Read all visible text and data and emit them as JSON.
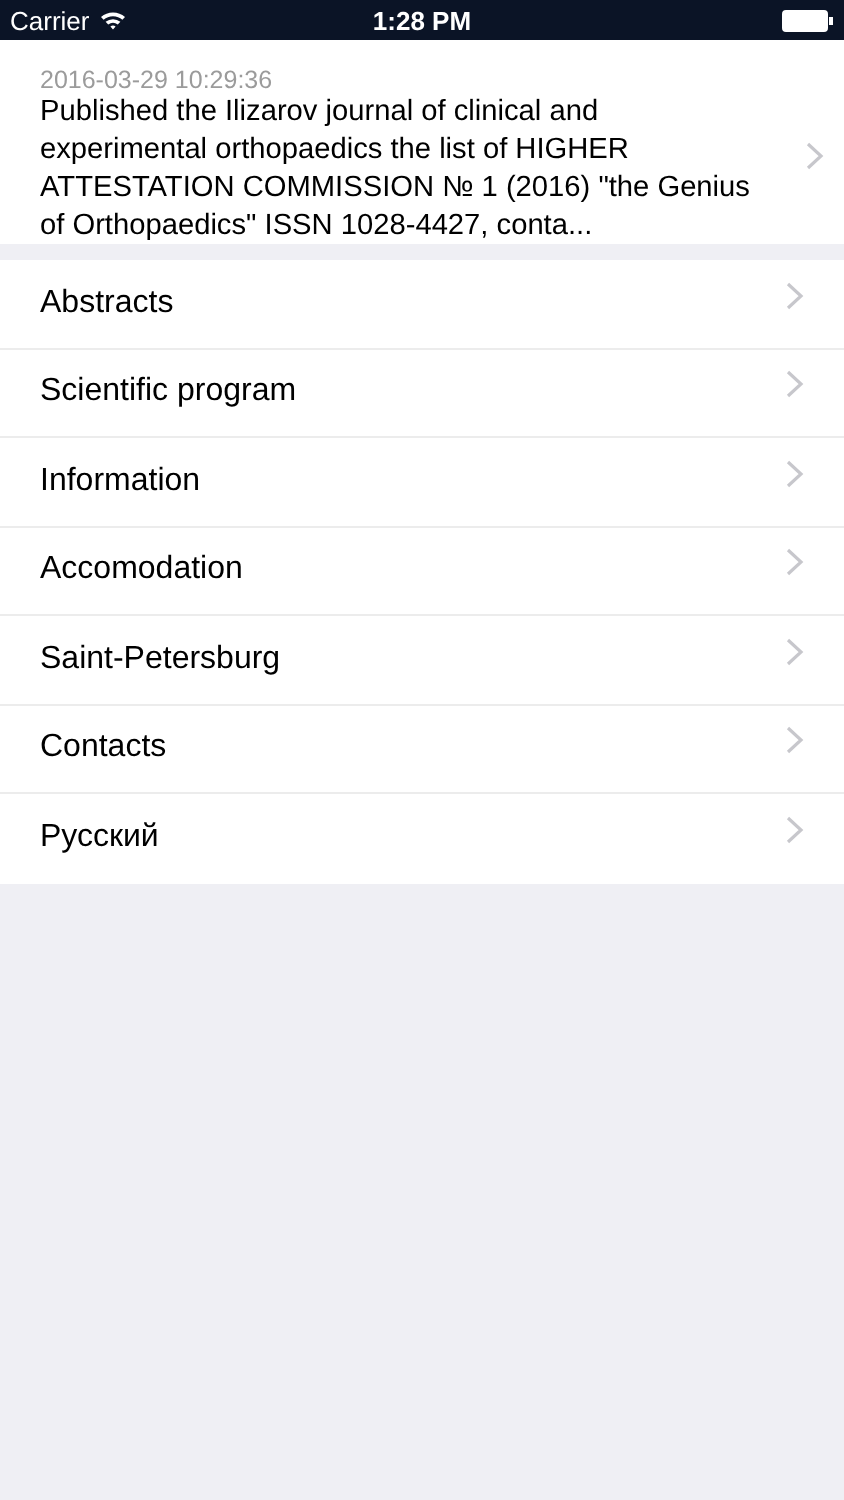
{
  "status_bar": {
    "carrier": "Carrier",
    "time": "1:28 PM"
  },
  "news": {
    "date": "2016-03-29 10:29:36",
    "text": "Published the Ilizarov journal of clinical and experimental orthopaedics the list of HIGHER ATTESTATION COMMISSION № 1 (2016) \"the Genius of Orthopaedics\" ISSN 1028-4427, conta..."
  },
  "menu": [
    {
      "label": "Abstracts"
    },
    {
      "label": "Scientific program"
    },
    {
      "label": "Information"
    },
    {
      "label": "Accomodation"
    },
    {
      "label": "Saint-Petersburg"
    },
    {
      "label": "Contacts"
    },
    {
      "label": "Русский"
    }
  ]
}
